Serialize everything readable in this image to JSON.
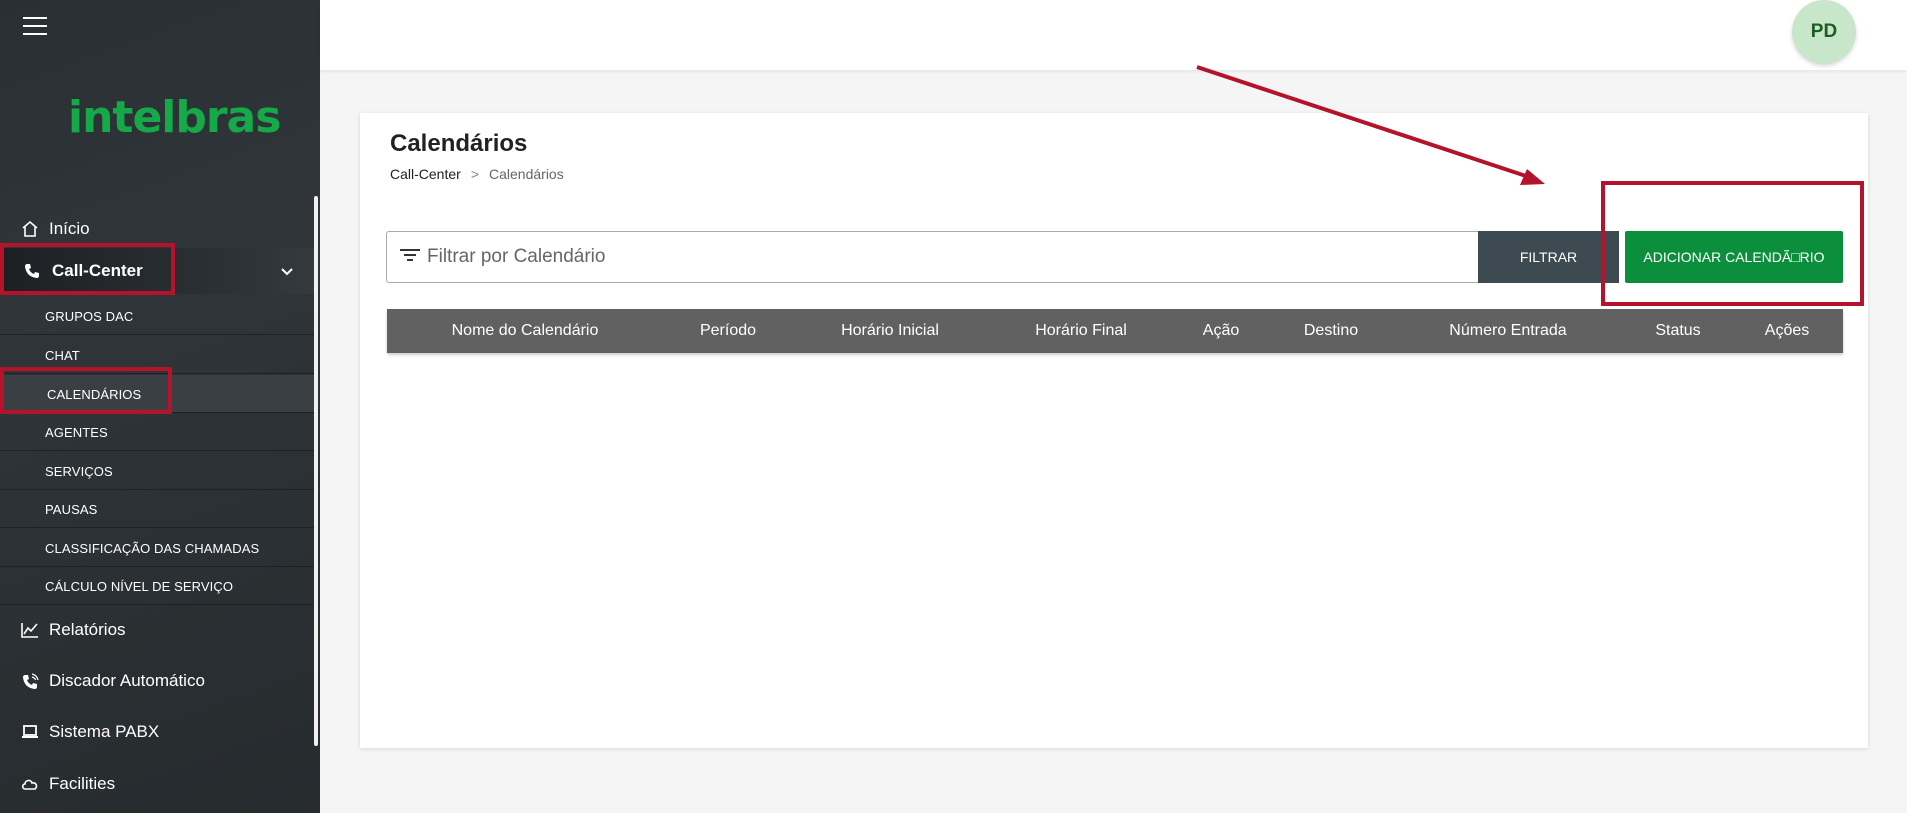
{
  "app": {
    "logo_text": "intelbras",
    "brand_color": "#16a94a"
  },
  "sidebar": {
    "items": [
      {
        "label": "Início",
        "icon": "home-icon"
      },
      {
        "label": "Call-Center",
        "icon": "phone-icon",
        "expanded": true
      },
      {
        "label": "Relatórios",
        "icon": "chart-icon"
      },
      {
        "label": "Discador Automático",
        "icon": "phone-dial-icon"
      },
      {
        "label": "Sistema PABX",
        "icon": "laptop-icon"
      },
      {
        "label": "Facilities",
        "icon": "cloud-icon"
      }
    ],
    "subitems": [
      {
        "label": "GRUPOS DAC"
      },
      {
        "label": "CHAT"
      },
      {
        "label": "CALENDÁRIOS",
        "active": true
      },
      {
        "label": "AGENTES"
      },
      {
        "label": "SERVIÇOS"
      },
      {
        "label": "PAUSAS"
      },
      {
        "label": "CLASSIFICAÇÃO DAS CHAMADAS"
      },
      {
        "label": "CÁLCULO NÍVEL DE SERVIÇO"
      }
    ]
  },
  "header": {
    "avatar_initials": "PD"
  },
  "main": {
    "title": "Calendários",
    "breadcrumb": {
      "parent": "Call-Center",
      "separator": ">",
      "current": "Calendários"
    },
    "filter": {
      "placeholder": "Filtrar por Calendário",
      "button_label": "FILTRAR"
    },
    "add_button_label": "ADICIONAR CALENDÃ□RIO",
    "table": {
      "columns": [
        "Nome do Calendário",
        "Período",
        "Horário Inicial",
        "Horário Final",
        "Ação",
        "Destino",
        "Número Entrada",
        "Status",
        "Ações"
      ],
      "rows": []
    }
  },
  "annotation": {
    "highlight_color": "#b5122b"
  }
}
